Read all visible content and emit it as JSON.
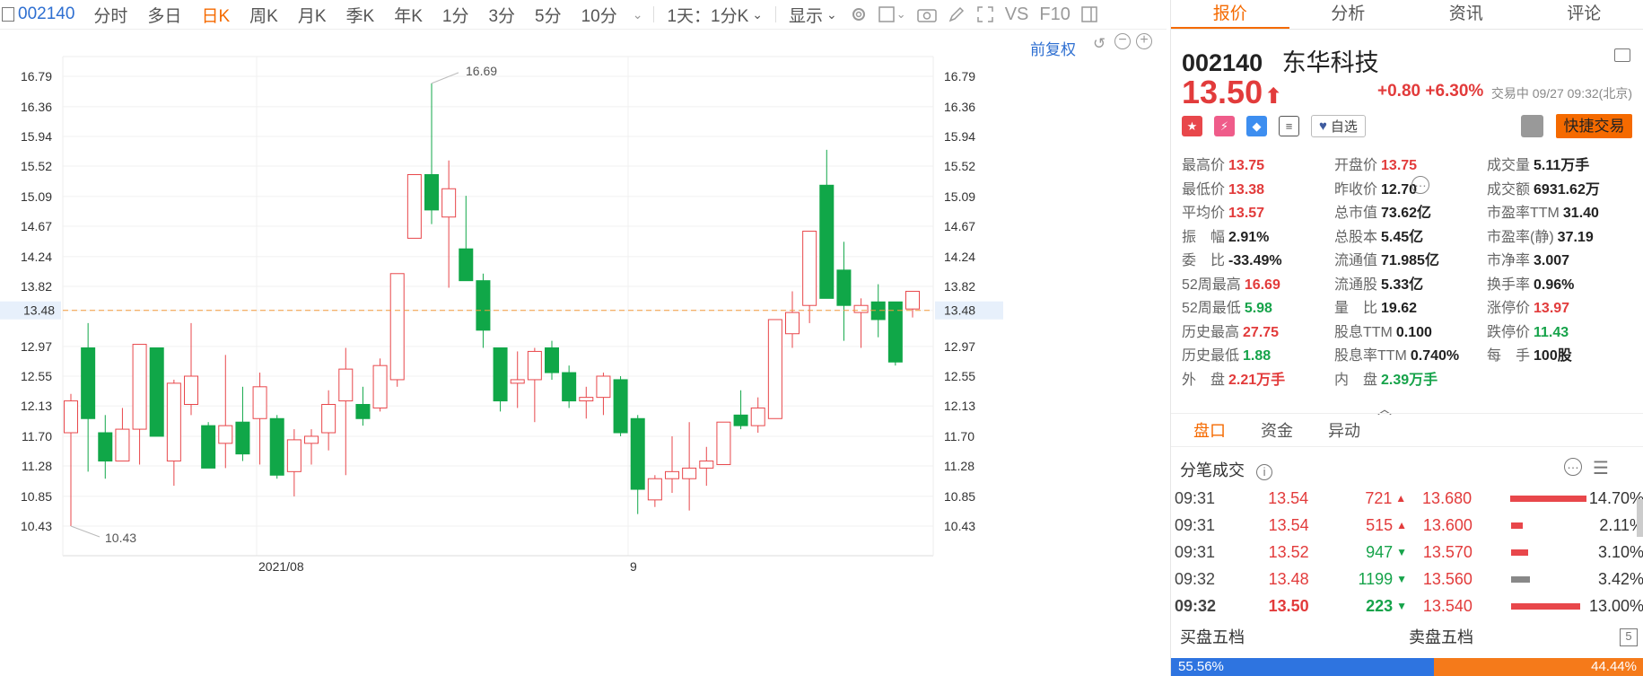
{
  "toolbar": {
    "code": "002140",
    "tabs": [
      "分时",
      "多日",
      "日K",
      "周K",
      "月K",
      "季K",
      "年K",
      "1分",
      "3分",
      "5分",
      "10分"
    ],
    "active_tab": "日K",
    "interval_select": "1天：1分K",
    "display_label": "显示",
    "vs_label": "VS",
    "f10_label": "F10"
  },
  "chart": {
    "fuquan_label": "前复权",
    "price_ticks": [
      "16.79",
      "16.36",
      "15.94",
      "15.52",
      "15.09",
      "14.67",
      "14.24",
      "13.82",
      "13.48",
      "12.97",
      "12.55",
      "12.13",
      "11.70",
      "11.28",
      "10.85",
      "10.43"
    ],
    "current_price_label": "13.48",
    "high_marker": "16.69",
    "low_marker": "10.43",
    "x_labels": [
      "2021/08",
      "9"
    ],
    "colors": {
      "up": "#e8474b",
      "down": "#10a748",
      "dash": "#f39a3c"
    }
  },
  "chart_data": {
    "type": "candlestick",
    "y_range": [
      10.2,
      17.0
    ],
    "current": 13.48,
    "candles": [
      {
        "o": 11.75,
        "c": 12.2,
        "h": 12.3,
        "l": 10.43
      },
      {
        "o": 12.95,
        "c": 11.95,
        "h": 13.3,
        "l": 11.2
      },
      {
        "o": 11.75,
        "c": 11.35,
        "h": 12.0,
        "l": 11.1
      },
      {
        "o": 11.35,
        "c": 11.8,
        "h": 12.1,
        "l": 11.35
      },
      {
        "o": 11.8,
        "c": 13.0,
        "h": 13.0,
        "l": 11.3
      },
      {
        "o": 12.95,
        "c": 11.7,
        "h": 12.95,
        "l": 11.7
      },
      {
        "o": 11.35,
        "c": 12.45,
        "h": 12.5,
        "l": 11.0
      },
      {
        "o": 12.15,
        "c": 12.55,
        "h": 13.3,
        "l": 12.0
      },
      {
        "o": 11.85,
        "c": 11.25,
        "h": 11.9,
        "l": 11.25
      },
      {
        "o": 11.6,
        "c": 11.85,
        "h": 12.85,
        "l": 11.25
      },
      {
        "o": 11.9,
        "c": 11.45,
        "h": 12.4,
        "l": 11.35
      },
      {
        "o": 11.95,
        "c": 12.4,
        "h": 12.6,
        "l": 11.3
      },
      {
        "o": 11.95,
        "c": 11.15,
        "h": 12.0,
        "l": 11.1
      },
      {
        "o": 11.2,
        "c": 11.65,
        "h": 11.8,
        "l": 10.85
      },
      {
        "o": 11.6,
        "c": 11.7,
        "h": 11.8,
        "l": 11.3
      },
      {
        "o": 11.75,
        "c": 12.15,
        "h": 12.35,
        "l": 11.5
      },
      {
        "o": 12.2,
        "c": 12.65,
        "h": 12.95,
        "l": 11.15
      },
      {
        "o": 12.15,
        "c": 11.95,
        "h": 12.4,
        "l": 11.85
      },
      {
        "o": 12.1,
        "c": 12.7,
        "h": 12.8,
        "l": 12.05
      },
      {
        "o": 12.5,
        "c": 14.0,
        "h": 14.0,
        "l": 12.4
      },
      {
        "o": 14.5,
        "c": 15.4,
        "h": 15.4,
        "l": 14.5
      },
      {
        "o": 15.4,
        "c": 14.9,
        "h": 16.69,
        "l": 14.7
      },
      {
        "o": 14.8,
        "c": 15.2,
        "h": 15.6,
        "l": 13.8
      },
      {
        "o": 14.35,
        "c": 13.9,
        "h": 15.1,
        "l": 13.9
      },
      {
        "o": 13.9,
        "c": 13.2,
        "h": 14.0,
        "l": 12.95
      },
      {
        "o": 12.95,
        "c": 12.2,
        "h": 12.95,
        "l": 12.05
      },
      {
        "o": 12.45,
        "c": 12.5,
        "h": 12.9,
        "l": 12.1
      },
      {
        "o": 12.5,
        "c": 12.9,
        "h": 12.95,
        "l": 11.9
      },
      {
        "o": 12.95,
        "c": 12.6,
        "h": 13.05,
        "l": 12.5
      },
      {
        "o": 12.6,
        "c": 12.2,
        "h": 12.7,
        "l": 12.1
      },
      {
        "o": 12.2,
        "c": 12.25,
        "h": 12.4,
        "l": 11.95
      },
      {
        "o": 12.25,
        "c": 12.55,
        "h": 12.6,
        "l": 12.0
      },
      {
        "o": 12.5,
        "c": 11.75,
        "h": 12.55,
        "l": 11.7
      },
      {
        "o": 11.95,
        "c": 10.95,
        "h": 12.0,
        "l": 10.6
      },
      {
        "o": 10.8,
        "c": 11.1,
        "h": 11.15,
        "l": 10.7
      },
      {
        "o": 11.1,
        "c": 11.2,
        "h": 11.7,
        "l": 10.9
      },
      {
        "o": 11.1,
        "c": 11.25,
        "h": 11.9,
        "l": 10.65
      },
      {
        "o": 11.25,
        "c": 11.35,
        "h": 11.55,
        "l": 11.0
      },
      {
        "o": 11.3,
        "c": 11.9,
        "h": 11.9,
        "l": 11.3
      },
      {
        "o": 12.0,
        "c": 11.85,
        "h": 12.35,
        "l": 11.8
      },
      {
        "o": 11.85,
        "c": 12.1,
        "h": 12.25,
        "l": 11.75
      },
      {
        "o": 11.95,
        "c": 13.35,
        "h": 13.35,
        "l": 11.95
      },
      {
        "o": 13.15,
        "c": 13.45,
        "h": 13.75,
        "l": 12.95
      },
      {
        "o": 13.55,
        "c": 14.6,
        "h": 14.6,
        "l": 13.3
      },
      {
        "o": 15.25,
        "c": 13.65,
        "h": 15.75,
        "l": 13.65
      },
      {
        "o": 14.05,
        "c": 13.55,
        "h": 14.45,
        "l": 13.05
      },
      {
        "o": 13.45,
        "c": 13.55,
        "h": 13.65,
        "l": 12.95
      },
      {
        "o": 13.6,
        "c": 13.35,
        "h": 13.85,
        "l": 13.1
      },
      {
        "o": 13.6,
        "c": 12.75,
        "h": 13.6,
        "l": 12.7
      },
      {
        "o": 13.5,
        "c": 13.75,
        "h": 13.75,
        "l": 13.38
      }
    ]
  },
  "panel": {
    "tabs": [
      "报价",
      "分析",
      "资讯",
      "评论"
    ],
    "active_tab": "报价",
    "code": "002140",
    "name": "东华科技",
    "price": "13.50",
    "change": "+0.80",
    "change_pct": "+6.30%",
    "trade_time": "交易中 09/27 09:32(北京)",
    "zixuan": "自选",
    "quick_trade": "快捷交易",
    "stats": [
      [
        {
          "k": "最高价",
          "v": "13.75",
          "c": "red"
        },
        {
          "k": "开盘价",
          "v": "13.75",
          "c": "red"
        },
        {
          "k": "成交量",
          "v": "5.11万手",
          "c": ""
        }
      ],
      [
        {
          "k": "最低价",
          "v": "13.38",
          "c": "red"
        },
        {
          "k": "昨收价",
          "v": "12.70",
          "c": ""
        },
        {
          "k": "成交额",
          "v": "6931.62万",
          "c": ""
        }
      ],
      [
        {
          "k": "平均价",
          "v": "13.57",
          "c": "red"
        },
        {
          "k": "总市值",
          "v": "73.62亿",
          "c": ""
        },
        {
          "k": "市盈率TTM",
          "v": "31.40",
          "c": ""
        }
      ],
      [
        {
          "k": "振　幅",
          "v": "2.91%",
          "c": ""
        },
        {
          "k": "总股本",
          "v": "5.45亿",
          "c": ""
        },
        {
          "k": "市盈率(静)",
          "v": "37.19",
          "c": ""
        }
      ],
      [
        {
          "k": "委　比",
          "v": "-33.49%",
          "c": ""
        },
        {
          "k": "流通值",
          "v": "71.985亿",
          "c": ""
        },
        {
          "k": "市净率",
          "v": "3.007",
          "c": ""
        }
      ],
      [
        {
          "k": "52周最高",
          "v": "16.69",
          "c": "red"
        },
        {
          "k": "流通股",
          "v": "5.33亿",
          "c": ""
        },
        {
          "k": "换手率",
          "v": "0.96%",
          "c": ""
        }
      ],
      [
        {
          "k": "52周最低",
          "v": "5.98",
          "c": "green"
        },
        {
          "k": "量　比",
          "v": "19.62",
          "c": ""
        },
        {
          "k": "涨停价",
          "v": "13.97",
          "c": "red"
        }
      ],
      [
        {
          "k": "历史最高",
          "v": "27.75",
          "c": "red"
        },
        {
          "k": "股息TTM",
          "v": "0.100",
          "c": ""
        },
        {
          "k": "跌停价",
          "v": "11.43",
          "c": "green"
        }
      ],
      [
        {
          "k": "历史最低",
          "v": "1.88",
          "c": "green"
        },
        {
          "k": "股息率TTM",
          "v": "0.740%",
          "c": ""
        },
        {
          "k": "每　手",
          "v": "100股",
          "c": ""
        }
      ],
      [
        {
          "k": "外　盘",
          "v": "2.21万手",
          "c": "red"
        },
        {
          "k": "内　盘",
          "v": "2.39万手",
          "c": "green"
        },
        {
          "k": "",
          "v": "",
          "c": ""
        }
      ]
    ],
    "subtabs": [
      "盘口",
      "资金",
      "异动"
    ],
    "active_subtab": "盘口",
    "tick_title": "分笔成交",
    "ticks": [
      {
        "time": "09:31",
        "price": "13.54",
        "vol": "721",
        "dir": "up",
        "lp": "13.680",
        "pct": "14.70%",
        "bar": 100,
        "bar_color": "#e8474b"
      },
      {
        "time": "09:31",
        "price": "13.54",
        "vol": "515",
        "dir": "up",
        "lp": "13.600",
        "pct": "2.11%",
        "bar": 15,
        "bar_color": "#e8474b"
      },
      {
        "time": "09:31",
        "price": "13.52",
        "vol": "947",
        "dir": "down",
        "lp": "13.570",
        "pct": "3.10%",
        "bar": 22,
        "bar_color": "#e8474b"
      },
      {
        "time": "09:32",
        "price": "13.48",
        "vol": "1199",
        "dir": "down",
        "lp": "13.560",
        "pct": "3.42%",
        "bar": 24,
        "bar_color": "#888888"
      },
      {
        "time": "09:32",
        "price": "13.50",
        "vol": "223",
        "dir": "down",
        "lp": "13.540",
        "pct": "13.00%",
        "bar": 90,
        "bar_color": "#e8474b"
      }
    ],
    "buy_label": "买盘五档",
    "sell_label": "卖盘五档",
    "buy_ratio": "55.56%",
    "sell_ratio": "44.44%",
    "buy_fraction": 0.5556
  }
}
